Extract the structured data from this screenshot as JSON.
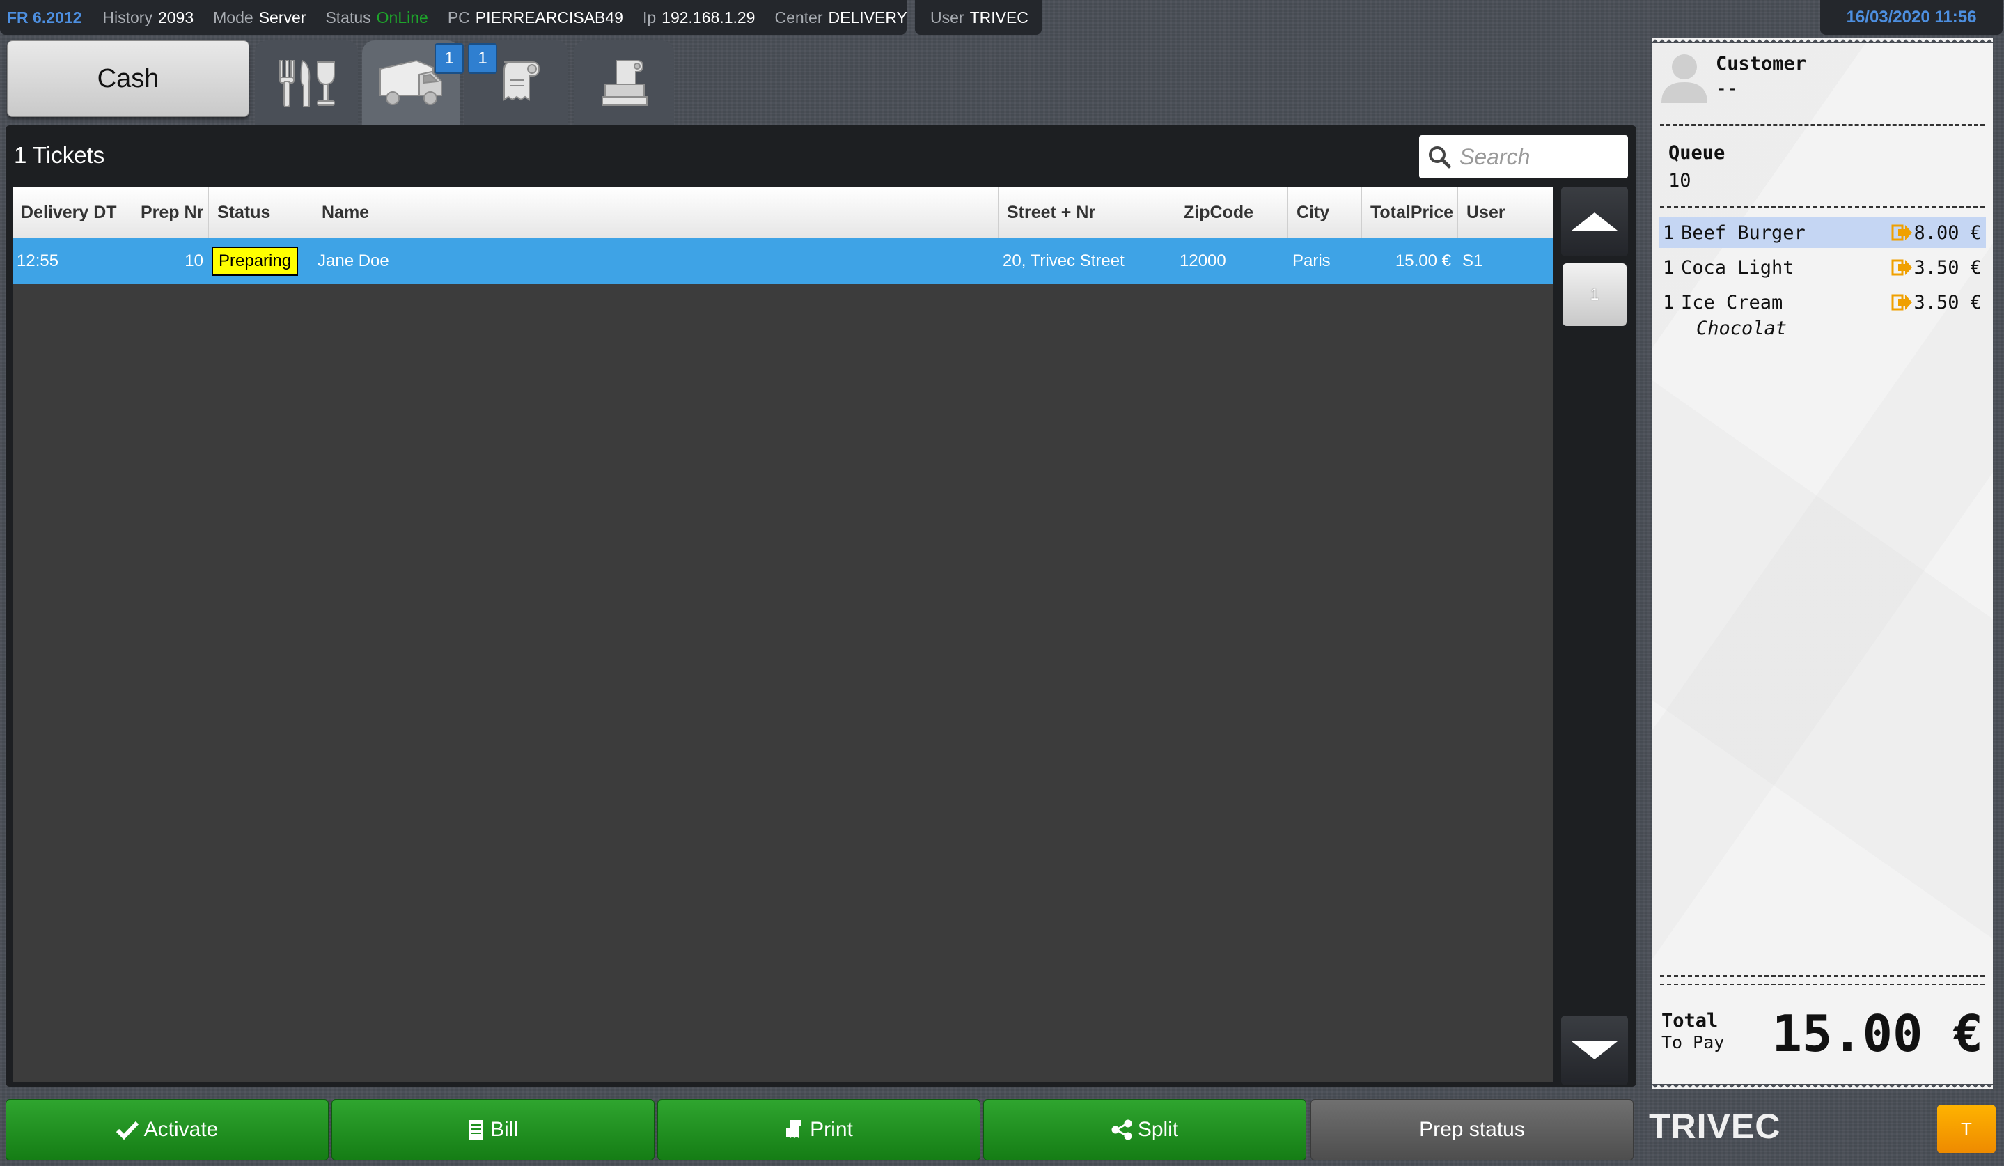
{
  "topbar": {
    "version": "FR 6.2012",
    "history_label": "History",
    "history_value": "2093",
    "mode_label": "Mode",
    "mode_value": "Server",
    "status_label": "Status",
    "status_value": "OnLine",
    "pc_label": "PC",
    "pc_value": "PIERREARCISAB49",
    "ip_label": "Ip",
    "ip_value": "192.168.1.29",
    "center_label": "Center",
    "center_value": "DELIVERY",
    "user_label": "User",
    "user_value": "TRIVEC",
    "datetime": "16/03/2020 11:56"
  },
  "tabs": {
    "cash_label": "Cash",
    "delivery_badge": "1",
    "takeaway_badge": "1",
    "icons": [
      "restaurant-icon",
      "delivery-truck-icon",
      "receipt-roll-icon",
      "printer-icon"
    ]
  },
  "main": {
    "ticket_count": "1 Tickets",
    "search_placeholder": "Search",
    "page": "1",
    "columns": [
      "Delivery DT",
      "Prep Nr",
      "Status",
      "Name",
      "Street + Nr",
      "ZipCode",
      "City",
      "TotalPrice",
      "User"
    ],
    "rows": [
      {
        "delivery_dt": "12:55",
        "prep_nr": "10",
        "status": "Preparing",
        "name": "Jane Doe",
        "street": "20, Trivec Street",
        "zipcode": "12000",
        "city": "Paris",
        "total": "15.00 €",
        "user": "S1"
      }
    ]
  },
  "actions": {
    "activate": "Activate",
    "bill": "Bill",
    "print": "Print",
    "split": "Split",
    "prep_status": "Prep status"
  },
  "receipt": {
    "customer_label": "Customer",
    "customer_value": "--",
    "queue_label": "Queue",
    "queue_value": "10",
    "items": [
      {
        "qty": "1",
        "name": "Beef Burger",
        "price": "8.00 €"
      },
      {
        "qty": "1",
        "name": "Coca Light",
        "price": "3.50 €"
      },
      {
        "qty": "1",
        "name": "Ice Cream",
        "price": "3.50 €"
      }
    ],
    "modifier": "Chocolat",
    "total_label": "Total",
    "to_pay_label": "To Pay",
    "total_value": "15.00 €"
  },
  "footer": {
    "brand": "TRIVEC",
    "t_button": "T"
  },
  "colors": {
    "accent_blue": "#3ea3e6",
    "action_green": "#1e8f1e",
    "status_yellow": "#ffff00",
    "online_green": "#1ea52b",
    "t_orange": "#f59a00"
  }
}
